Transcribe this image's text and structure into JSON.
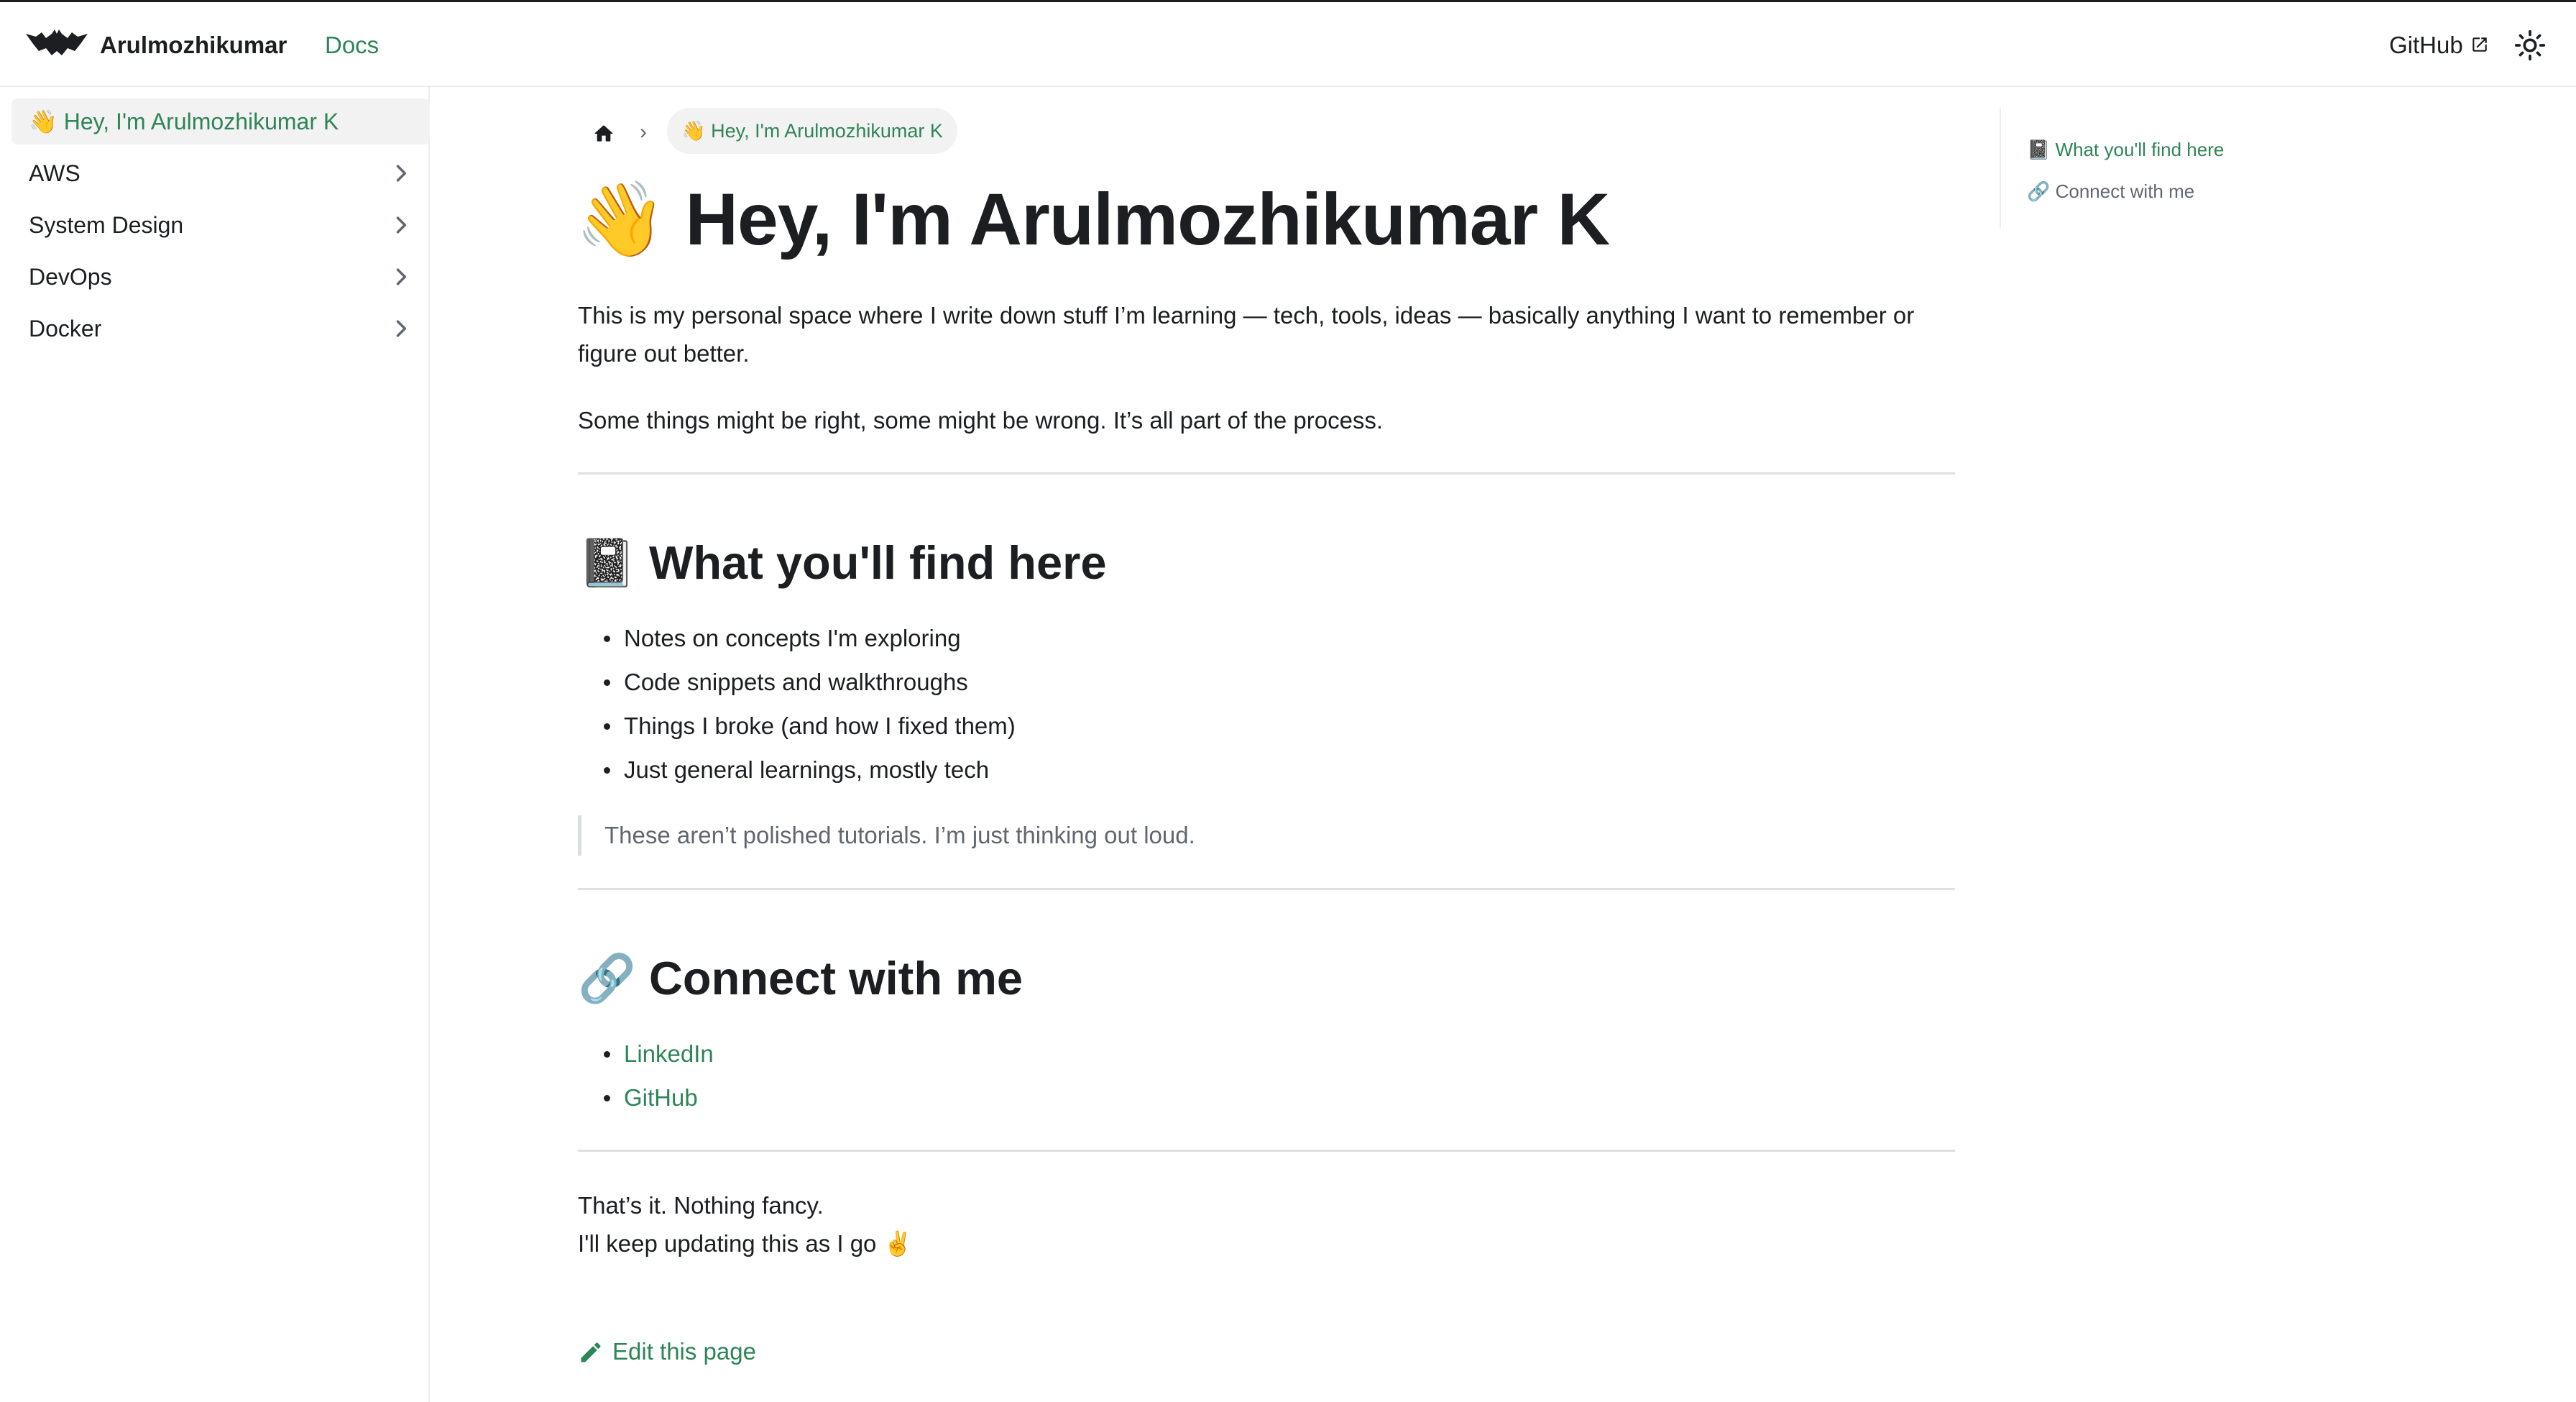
{
  "navbar": {
    "logo_icon": "bat-icon",
    "title": "Arulmozhikumar",
    "docs_link": "Docs",
    "github_link": "GitHub",
    "external_icon": "external-link-icon",
    "theme_icon": "sun-icon"
  },
  "sidebar": {
    "items": [
      {
        "label": "👋 Hey, I'm Arulmozhikumar K",
        "active": true
      },
      {
        "label": "AWS",
        "icon": "chevron-right-icon"
      },
      {
        "label": "System Design",
        "icon": "chevron-right-icon"
      },
      {
        "label": "DevOps",
        "icon": "chevron-right-icon"
      },
      {
        "label": "Docker",
        "icon": "chevron-right-icon"
      }
    ]
  },
  "breadcrumb": {
    "home_icon": "home-icon",
    "separator": "›",
    "current": "👋 Hey, I'm Arulmozhikumar K"
  },
  "article": {
    "title": "👋 Hey, I'm Arulmozhikumar K",
    "intro_1": "This is my personal space where I write down stuff I’m learning — tech, tools, ideas — basically anything I want to remember or figure out better.",
    "intro_2": "Some things might be right, some might be wrong. It’s all part of the process.",
    "section_1": {
      "heading": "📓 What you'll find here",
      "items": [
        "Notes on concepts I'm exploring",
        "Code snippets and walkthroughs",
        "Things I broke (and how I fixed them)",
        "Just general learnings, mostly tech"
      ],
      "quote": "These aren’t polished tutorials. I’m just thinking out loud."
    },
    "section_2": {
      "heading": "🔗 Connect with me",
      "links": [
        "LinkedIn",
        "GitHub"
      ]
    },
    "outro_1": "That’s it. Nothing fancy.",
    "outro_2": "I'll keep updating this as I go ✌️",
    "edit_label": "Edit this page",
    "edit_icon": "pencil-icon"
  },
  "toc": {
    "items": [
      "📓 What you'll find here",
      "🔗 Connect with me"
    ]
  },
  "colors": {
    "accent": "#2e8555",
    "text": "#1c1e21",
    "muted": "#606770",
    "active_bg": "#f2f2f3"
  }
}
